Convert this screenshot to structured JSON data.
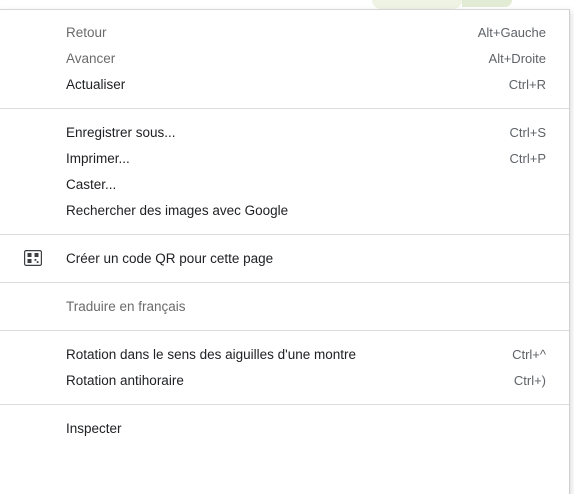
{
  "context_menu": {
    "groups": [
      [
        {
          "label": "Retour",
          "shortcut": "Alt+Gauche",
          "disabled": true
        },
        {
          "label": "Avancer",
          "shortcut": "Alt+Droite",
          "disabled": true
        },
        {
          "label": "Actualiser",
          "shortcut": "Ctrl+R",
          "disabled": false
        }
      ],
      [
        {
          "label": "Enregistrer sous...",
          "shortcut": "Ctrl+S",
          "disabled": false
        },
        {
          "label": "Imprimer...",
          "shortcut": "Ctrl+P",
          "disabled": false
        },
        {
          "label": "Caster...",
          "shortcut": "",
          "disabled": false
        },
        {
          "label": "Rechercher des images avec Google",
          "shortcut": "",
          "disabled": false
        }
      ],
      [
        {
          "label": "Créer un code QR pour cette page",
          "shortcut": "",
          "disabled": false,
          "icon": "qr-code-icon"
        }
      ],
      [
        {
          "label": "Traduire en français",
          "shortcut": "",
          "disabled": true
        }
      ],
      [
        {
          "label": "Rotation dans le sens des aiguilles d'une montre",
          "shortcut": "Ctrl+^",
          "disabled": false
        },
        {
          "label": "Rotation antihoraire",
          "shortcut": "Ctrl+)",
          "disabled": false
        }
      ],
      [
        {
          "label": "Inspecter",
          "shortcut": "",
          "disabled": false
        }
      ]
    ]
  },
  "colors": {
    "text": "#202124",
    "disabled_text": "#6b6b6b",
    "shortcut_text": "#5f6368",
    "separator": "#dadce0",
    "background": "#ffffff"
  }
}
